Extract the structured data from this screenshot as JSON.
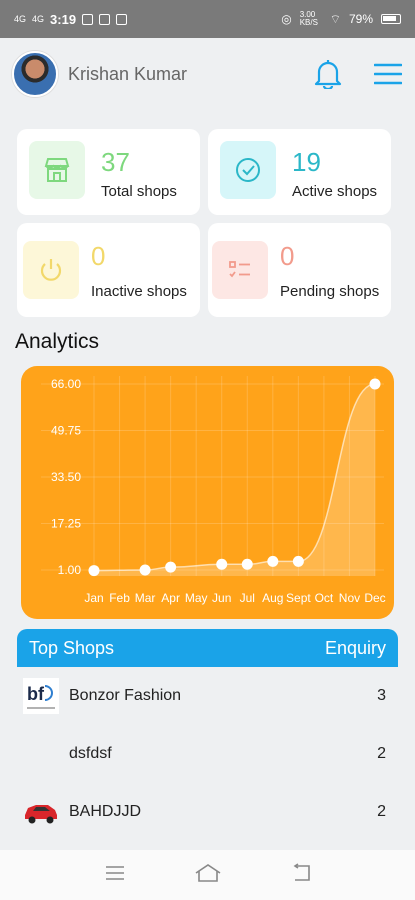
{
  "status_bar": {
    "net1": "4G",
    "net2": "4G",
    "time": "3:19",
    "data_speed": "3.00 KB/S",
    "battery": "79%"
  },
  "user": {
    "name": "Krishan Kumar"
  },
  "stats": [
    {
      "value": "37",
      "label": "Total shops",
      "color": "#7ed87e",
      "bg": "#e7f8e7",
      "icon": "shop-icon"
    },
    {
      "value": "19",
      "label": "Active shops",
      "color": "#2bb7c8",
      "bg": "#d6f6f9",
      "icon": "check-circle-icon"
    },
    {
      "value": "0",
      "label": "Inactive shops",
      "color": "#f2d86a",
      "bg": "#fdf7d8",
      "icon": "power-icon"
    },
    {
      "value": "0",
      "label": "Pending shops",
      "color": "#f29b8c",
      "bg": "#fde7e4",
      "icon": "checklist-icon"
    }
  ],
  "analytics": {
    "title": "Analytics"
  },
  "chart_data": {
    "type": "area",
    "categories": [
      "Jan",
      "Feb",
      "Mar",
      "Apr",
      "May",
      "Jun",
      "Jul",
      "Aug",
      "Sept",
      "Oct",
      "Nov",
      "Dec"
    ],
    "tick_labels": [
      "66.00",
      "49.75",
      "33.50",
      "17.25",
      "1.00"
    ],
    "ylim": [
      1,
      66
    ],
    "series": [
      {
        "points": [
          {
            "x": "Jan",
            "y": 0
          },
          {
            "x": "Mar",
            "y": 1
          },
          {
            "x": "Apr",
            "y": 2
          },
          {
            "x": "Jun",
            "y": 3
          },
          {
            "x": "Jul",
            "y": 3
          },
          {
            "x": "Aug",
            "y": 4
          },
          {
            "x": "Sept",
            "y": 4
          },
          {
            "x": "Dec",
            "y": 66
          }
        ]
      }
    ],
    "grid": true,
    "colors": {
      "background": "#ffa31a",
      "line": "#ffffff"
    }
  },
  "top_shops": {
    "header": "Top Shops",
    "enquiry_header": "Enquiry",
    "rows": [
      {
        "name": "Bonzor Fashion",
        "count": "3",
        "logo": "bonzor-logo"
      },
      {
        "name": "dsfdsf",
        "count": "2",
        "logo": ""
      },
      {
        "name": "BAHDJJD",
        "count": "2",
        "logo": "car-logo"
      }
    ]
  },
  "nav": {
    "items": [
      "menu-icon",
      "home-icon",
      "back-icon"
    ]
  }
}
